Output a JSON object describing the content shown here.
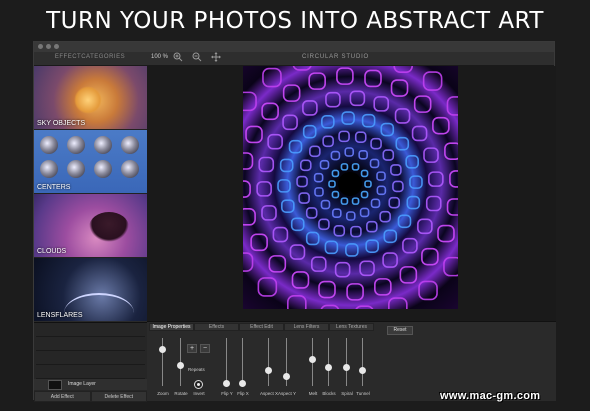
{
  "headline": "TURN YOUR PHOTOS INTO ABSTRACT ART",
  "window": {
    "title": "CIRCULAR STUDIO",
    "sidebar_title": "EFFECTCATEGORIES",
    "zoom_level": "100 %"
  },
  "toolbar_icons": [
    "zoom-in-icon",
    "zoom-out-icon",
    "move-icon"
  ],
  "categories": [
    {
      "label": "SKY OBJECTS"
    },
    {
      "label": "CENTERS"
    },
    {
      "label": "CLOUDS"
    },
    {
      "label": "LENSFLARES"
    }
  ],
  "layers": {
    "layer_name": "Image Layer",
    "add_effect": "Add Effect",
    "delete_effect": "Delete Effect"
  },
  "properties": {
    "tabs": [
      "Image Properties",
      "Effects",
      "Effect Edit",
      "Lens Filters",
      "Lens Textures"
    ],
    "active_tab": 0,
    "reset_label": "Reset",
    "repeats_label": "Repeats",
    "plus_label": "+",
    "minus_label": "−",
    "invert_label": "Invert",
    "sliders": [
      {
        "label": "Zoom",
        "value": 0.82
      },
      {
        "label": "Rotate",
        "value": 0.45
      },
      {
        "label": "Flip Y",
        "value": 0.05
      },
      {
        "label": "Flip X",
        "value": 0.05
      },
      {
        "label": "Aspect X",
        "value": 0.35
      },
      {
        "label": "Aspect Y",
        "value": 0.2
      },
      {
        "label": "Melt",
        "value": 0.6
      },
      {
        "label": "Blocks",
        "value": 0.4
      },
      {
        "label": "Spiral",
        "value": 0.4
      },
      {
        "label": "Tunnel",
        "value": 0.35
      }
    ]
  },
  "watermark": "www.mac-gm.com"
}
